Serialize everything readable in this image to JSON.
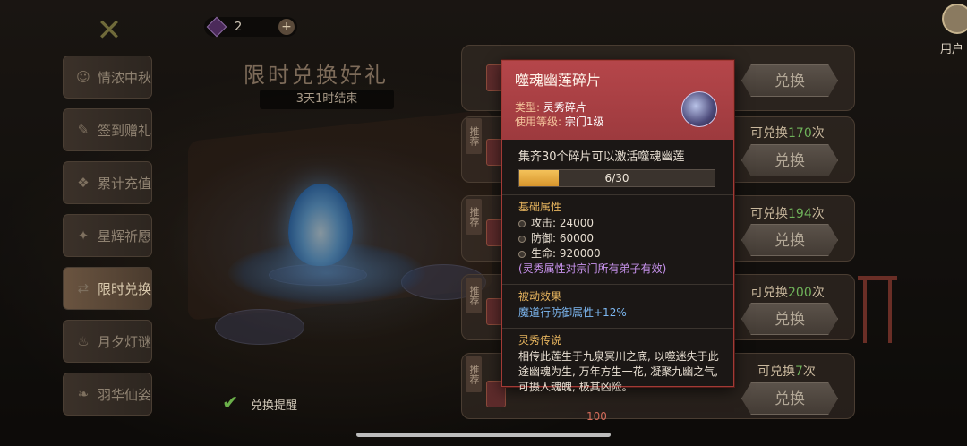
{
  "colors": {
    "tooltip_header": "#b5464a",
    "accent_gold": "#e6b45e",
    "quota_green": "#6fb25a",
    "lore_purple": "#c792ec",
    "passive_blue": "#7db8f2"
  },
  "menu": {
    "items": [
      {
        "label": "情浓中秋",
        "icon": "mask-icon",
        "active": false
      },
      {
        "label": "签到赠礼",
        "icon": "scroll-icon",
        "active": false
      },
      {
        "label": "累计充值",
        "icon": "coin-bag-icon",
        "active": false
      },
      {
        "label": "星辉祈愿",
        "icon": "star-icon",
        "active": false
      },
      {
        "label": "限时兑换",
        "icon": "exchange-icon",
        "active": true
      },
      {
        "label": "月夕灯谜",
        "icon": "lantern-icon",
        "active": false
      },
      {
        "label": "羽华仙姿",
        "icon": "feather-icon",
        "active": false
      }
    ]
  },
  "currency": {
    "amount": "2",
    "icon": "gem-icon"
  },
  "event": {
    "title": "限时兑换好礼",
    "timer": "3天1时结束"
  },
  "remind": {
    "label": "兑换提醒"
  },
  "user": {
    "label": "用户"
  },
  "list": {
    "recommend_tag": "推荐",
    "button_label": "兑换",
    "quota_prefix": "可兑换",
    "quota_suffix": "次",
    "rows": [
      {
        "quota": ""
      },
      {
        "quota": "170"
      },
      {
        "quota": "194"
      },
      {
        "quota": "200"
      },
      {
        "quota": "7"
      }
    ],
    "badge_partial": "100"
  },
  "tooltip": {
    "name": "噬魂幽莲碎片",
    "type_key": "类型:",
    "type_val": "灵秀碎片",
    "level_key": "使用等级:",
    "level_val": "宗门1级",
    "collect_text": "集齐30个碎片可以激活噬魂幽莲",
    "progress": {
      "current": 6,
      "total": 30,
      "label": "6/30"
    },
    "basic_title": "基础属性",
    "stats": [
      "攻击: 24000",
      "防御: 60000",
      "生命: 920000"
    ],
    "stats_note": "(灵秀属性对宗门所有弟子有效)",
    "passive_title": "被动效果",
    "passive": "魔道行防御属性+12%",
    "lore_title": "灵秀传说",
    "lore": "相传此莲生于九泉冥川之底, 以噬迷失于此途幽魂为生, 万年方生一花, 凝聚九幽之气, 可摄人魂魄, 极其凶险。"
  }
}
